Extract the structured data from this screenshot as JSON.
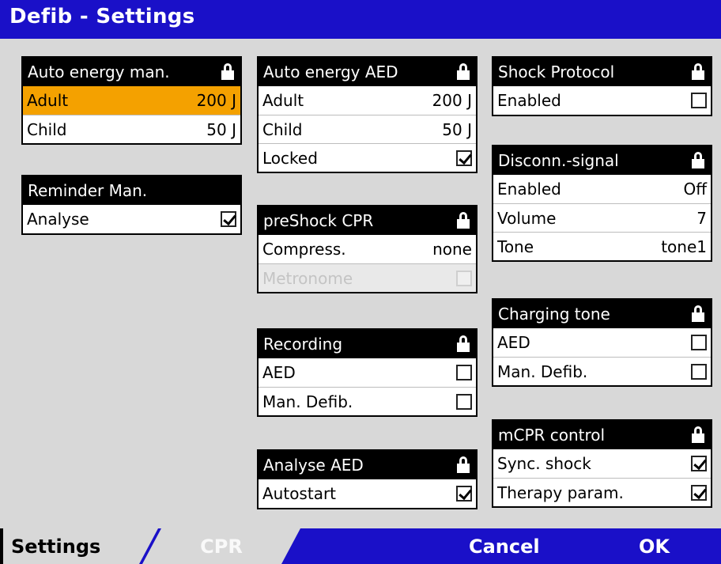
{
  "title": "Defib - Settings",
  "panels": {
    "auto_energy_man": {
      "header": "Auto energy man.",
      "rows": [
        {
          "label": "Adult",
          "value": "200 J"
        },
        {
          "label": "Child",
          "value": "50 J"
        }
      ]
    },
    "reminder_man": {
      "header": "Reminder Man.",
      "rows": [
        {
          "label": "Analyse",
          "checked": true
        }
      ]
    },
    "auto_energy_aed": {
      "header": "Auto energy AED",
      "rows": [
        {
          "label": "Adult",
          "value": "200 J"
        },
        {
          "label": "Child",
          "value": "50 J"
        },
        {
          "label": "Locked",
          "checked": true
        }
      ]
    },
    "preshock_cpr": {
      "header": "preShock CPR",
      "rows": [
        {
          "label": "Compress.",
          "value": "none"
        },
        {
          "label": "Metronome",
          "checked": false
        }
      ]
    },
    "recording": {
      "header": "Recording",
      "rows": [
        {
          "label": "AED",
          "checked": false
        },
        {
          "label": "Man. Defib.",
          "checked": false
        }
      ]
    },
    "analyse_aed": {
      "header": "Analyse AED",
      "rows": [
        {
          "label": "Autostart",
          "checked": true
        }
      ]
    },
    "shock_protocol": {
      "header": "Shock Protocol",
      "rows": [
        {
          "label": "Enabled",
          "checked": false
        }
      ]
    },
    "disconn_signal": {
      "header": "Disconn.-signal",
      "rows": [
        {
          "label": "Enabled",
          "value": "Off"
        },
        {
          "label": "Volume",
          "value": "7"
        },
        {
          "label": "Tone",
          "value": "tone1"
        }
      ]
    },
    "charging_tone": {
      "header": "Charging tone",
      "rows": [
        {
          "label": "AED",
          "checked": false
        },
        {
          "label": "Man. Defib.",
          "checked": false
        }
      ]
    },
    "mcpr_control": {
      "header": "mCPR control",
      "rows": [
        {
          "label": "Sync. shock",
          "checked": true
        },
        {
          "label": "Therapy param.",
          "checked": true
        }
      ]
    }
  },
  "footer": {
    "tab_settings": "Settings",
    "tab_cpr": "CPR",
    "cancel": "Cancel",
    "ok": "OK"
  },
  "colors": {
    "title_bar": "#1a10c8",
    "selected_row": "#f4a100",
    "background": "#d8d8d8"
  },
  "icons": {
    "lock": "lock-icon",
    "checkbox": "checkbox"
  }
}
